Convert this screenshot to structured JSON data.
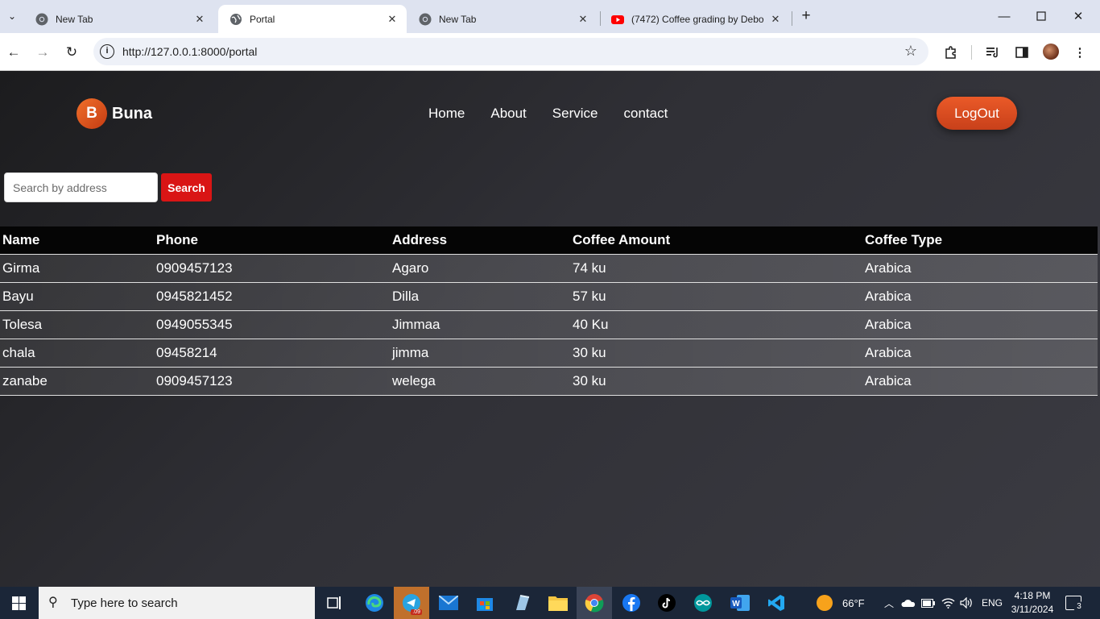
{
  "browser": {
    "tabs": [
      {
        "title": "New Tab",
        "favicon": "chrome-icon",
        "active": false
      },
      {
        "title": "Portal",
        "favicon": "globe-icon",
        "active": true
      },
      {
        "title": "New Tab",
        "favicon": "chrome-icon",
        "active": false
      },
      {
        "title": "(7472) Coffee grading by Debo",
        "favicon": "youtube-icon",
        "active": false
      }
    ],
    "url": "http://127.0.0.1:8000/portal"
  },
  "header": {
    "logo_letter": "B",
    "brand": "Buna",
    "nav": [
      "Home",
      "About",
      "Service",
      "contact"
    ],
    "logout_label": "LogOut"
  },
  "search": {
    "placeholder": "Search by address",
    "button_label": "Search"
  },
  "table": {
    "columns": [
      "Name",
      "Phone",
      "Address",
      "Coffee Amount",
      "Coffee Type"
    ],
    "rows": [
      [
        "Girma",
        "0909457123",
        "Agaro",
        "74 ku",
        "Arabica"
      ],
      [
        "Bayu",
        "0945821452",
        "Dilla",
        "57 ku",
        "Arabica"
      ],
      [
        "Tolesa",
        "0949055345",
        "Jimmaa",
        "40 Ku",
        "Arabica"
      ],
      [
        "chala",
        "09458214",
        "jimma",
        "30 ku",
        "Arabica"
      ],
      [
        "zanabe",
        "0909457123",
        "welega",
        "30 ku",
        "Arabica"
      ]
    ]
  },
  "taskbar": {
    "search_placeholder": "Type here to search",
    "telegram_badge": ".09",
    "weather": "66°F",
    "language": "ENG",
    "time": "4:18 PM",
    "date": "3/11/2024",
    "notification_count": "3"
  },
  "colors": {
    "accent_orange": "#e2501f",
    "search_red": "#d91515",
    "table_head": "#050505",
    "taskbar": "#1b2638"
  }
}
